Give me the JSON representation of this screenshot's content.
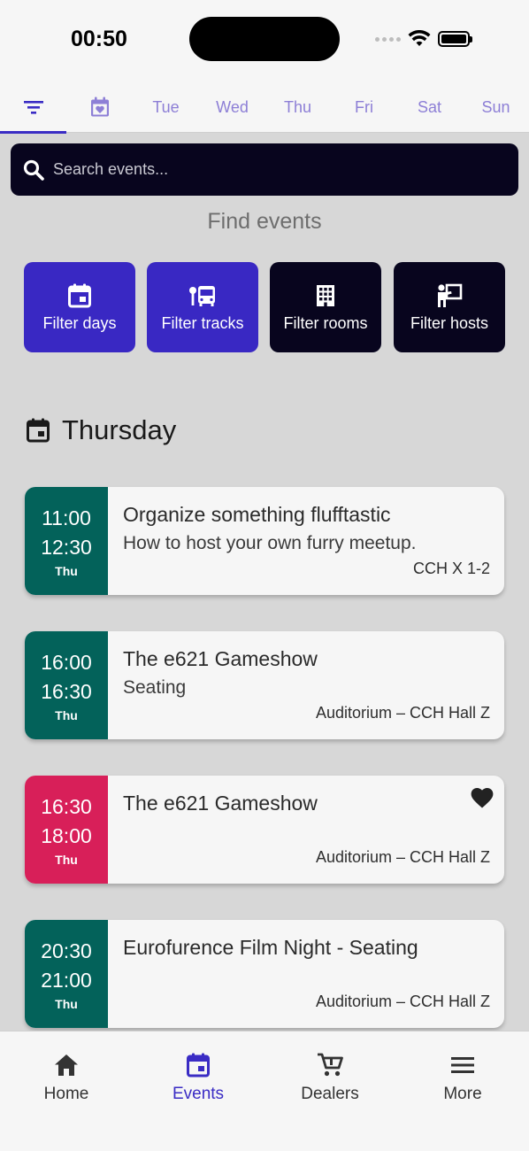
{
  "status_bar": {
    "time": "00:50"
  },
  "day_tabs": [
    {
      "kind": "filter-icon"
    },
    {
      "kind": "favorites-calendar-icon"
    },
    {
      "label": "Tue"
    },
    {
      "label": "Wed"
    },
    {
      "label": "Thu"
    },
    {
      "label": "Fri"
    },
    {
      "label": "Sat"
    },
    {
      "label": "Sun"
    }
  ],
  "search": {
    "placeholder": "Search events..."
  },
  "find_title": "Find events",
  "filters": [
    {
      "label": "Filter days",
      "icon": "calendar-icon",
      "style": "accent"
    },
    {
      "label": "Filter tracks",
      "icon": "bus-stop-icon",
      "style": "accent"
    },
    {
      "label": "Filter rooms",
      "icon": "building-icon",
      "style": "dark"
    },
    {
      "label": "Filter hosts",
      "icon": "presenter-icon",
      "style": "dark"
    }
  ],
  "section": {
    "title": "Thursday",
    "icon": "calendar-icon"
  },
  "events": [
    {
      "start": "11:00",
      "end": "12:30",
      "day": "Thu",
      "title": "Organize something flufftastic",
      "subtitle": "How to host your own furry meetup.",
      "location": "CCH X 1-2",
      "color": "#03625a",
      "favorite": false
    },
    {
      "start": "16:00",
      "end": "16:30",
      "day": "Thu",
      "title": "The e621 Gameshow",
      "subtitle": "Seating",
      "location": "Auditorium – CCH Hall Z",
      "color": "#03625a",
      "favorite": false
    },
    {
      "start": "16:30",
      "end": "18:00",
      "day": "Thu",
      "title": "The e621 Gameshow",
      "subtitle": "",
      "location": "Auditorium – CCH Hall Z",
      "color": "#d81f59",
      "favorite": true
    },
    {
      "start": "20:30",
      "end": "21:00",
      "day": "Thu",
      "title": "Eurofurence Film Night - Seating",
      "subtitle": "",
      "location": "Auditorium – CCH Hall Z",
      "color": "#03625a",
      "favorite": false
    }
  ],
  "bottom_nav": [
    {
      "label": "Home",
      "icon": "home-icon",
      "active": false
    },
    {
      "label": "Events",
      "icon": "calendar-icon",
      "active": true
    },
    {
      "label": "Dealers",
      "icon": "cart-icon",
      "active": false
    },
    {
      "label": "More",
      "icon": "menu-icon",
      "active": false
    }
  ],
  "colors": {
    "accent": "#3928c3",
    "dark": "#08051e",
    "event_green": "#03625a",
    "event_favorite": "#d81f59"
  }
}
